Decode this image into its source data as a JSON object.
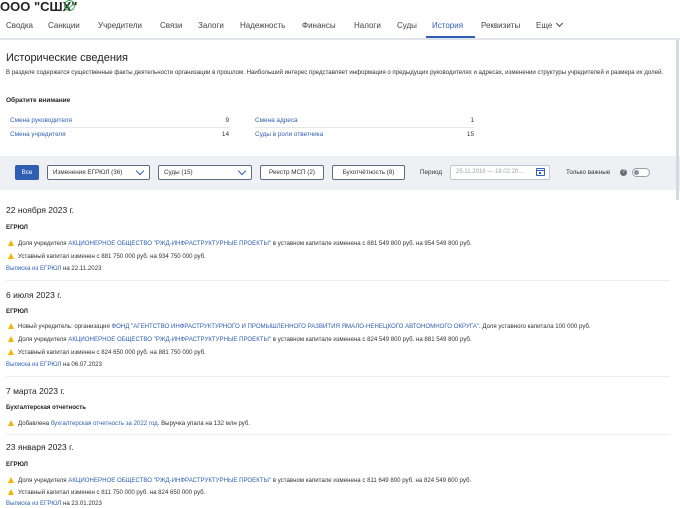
{
  "header": {
    "org_name": "ООО \"СШХ\"",
    "verified_icon": "check-circle-icon"
  },
  "tabs": [
    {
      "label": "Сводка"
    },
    {
      "label": "Санкции"
    },
    {
      "label": "Учредители"
    },
    {
      "label": "Связи"
    },
    {
      "label": "Залоги"
    },
    {
      "label": "Надежность"
    },
    {
      "label": "Финансы"
    },
    {
      "label": "Налоги"
    },
    {
      "label": "Суды"
    },
    {
      "label": "История",
      "active": true
    },
    {
      "label": "Реквизиты"
    },
    {
      "label": "Еще"
    }
  ],
  "history": {
    "title": "Исторические сведения",
    "description": "В разделе содержатся существенные факты деятельности организации в прошлом. Наибольший интерес представляет информация о предыдущих руководителях и адресах, изменении структуры учредителей и размера их долей.",
    "attention": "Обратите внимание",
    "stats": [
      {
        "label": "Смена руководителя",
        "count": "9"
      },
      {
        "label": "Смена адреса",
        "count": "1"
      },
      {
        "label": "Смена учредителя",
        "count": "14"
      },
      {
        "label": "Суды в роли ответчика",
        "count": "15"
      }
    ]
  },
  "filters": {
    "all": "Все",
    "egrul_dropdown": "Изменения ЕГРЮЛ (36)",
    "courts_dropdown": "Суды (15)",
    "msp_button": "Реестр МСП (2)",
    "accounting_button": "Бухотчётность (8)",
    "period_label": "Период",
    "period_value": "25.11.2016 — 18.02.20...",
    "important_label": "Только важные",
    "important_toggle": false
  },
  "events": [
    {
      "date": "22 ноября 2023 г.",
      "source": "ЕГРЮЛ",
      "lines": [
        {
          "pre": "Доля учредителя ",
          "link": "АКЦИОНЕРНОЕ ОБЩЕСТВО \"РЖД-ИНФРАСТРУКТУРНЫЕ ПРОЕКТЫ\"",
          "post": " в уставном капитале изменена с 881 549 800 руб. на 954 549 800 руб."
        },
        {
          "pre": "Уставный капитал изменен с 881 750 000 руб. на 934 750 000 руб.",
          "link": "",
          "post": ""
        }
      ],
      "extract_link": "Выписка из ЕГРЮЛ",
      "extract_date": " на 22.11.2023"
    },
    {
      "date": "6 июля 2023 г.",
      "source": "ЕГРЮЛ",
      "lines": [
        {
          "pre": "Новый учредитель: организация ",
          "link": "ФОНД \"АГЕНТСТВО ИНФРАСТРУКТУРНОГО И ПРОМЫШЛЕННОГО РАЗВИТИЯ ЯМАЛО-НЕНЕЦКОГО АВТОНОМНОГО ОКРУГА\"",
          "post": ". Доля уставного капитала 100 000 руб."
        },
        {
          "pre": "Доля учредителя ",
          "link": "АКЦИОНЕРНОЕ ОБЩЕСТВО \"РЖД-ИНФРАСТРУКТУРНЫЕ ПРОЕКТЫ\"",
          "post": " в уставном капитале изменена с 824 549 800 руб. на 881 549 800 руб."
        },
        {
          "pre": "Уставный капитал изменен с 824 650 000 руб. на 881 750 000 руб.",
          "link": "",
          "post": ""
        }
      ],
      "extract_link": "Выписка из ЕГРЮЛ",
      "extract_date": " на 06.07.2023"
    },
    {
      "date": "7 марта 2023 г.",
      "source": "Бухгалтерская отчетность",
      "lines": [
        {
          "pre": "Добавлена ",
          "link": "бухгалтерская отчетность за 2022 год",
          "post": ". Выручка упала на 132 млн руб."
        }
      ],
      "extract_link": "",
      "extract_date": ""
    },
    {
      "date": "23 января 2023 г.",
      "source": "ЕГРЮЛ",
      "lines": [
        {
          "pre": "Доля учредителя ",
          "link": "АКЦИОНЕРНОЕ ОБЩЕСТВО \"РЖД-ИНФРАСТРУКТУРНЫЕ ПРОЕКТЫ\"",
          "post": " в уставном капитале изменена с 811 649 800 руб. на 824 549 800 руб."
        },
        {
          "pre": "Уставный капитал изменен с 811 750 000 руб. на 824 650 000 руб.",
          "link": "",
          "post": ""
        }
      ],
      "extract_link": "Выписка из ЕГРЮЛ",
      "extract_date": " на 23.01.2023"
    }
  ]
}
